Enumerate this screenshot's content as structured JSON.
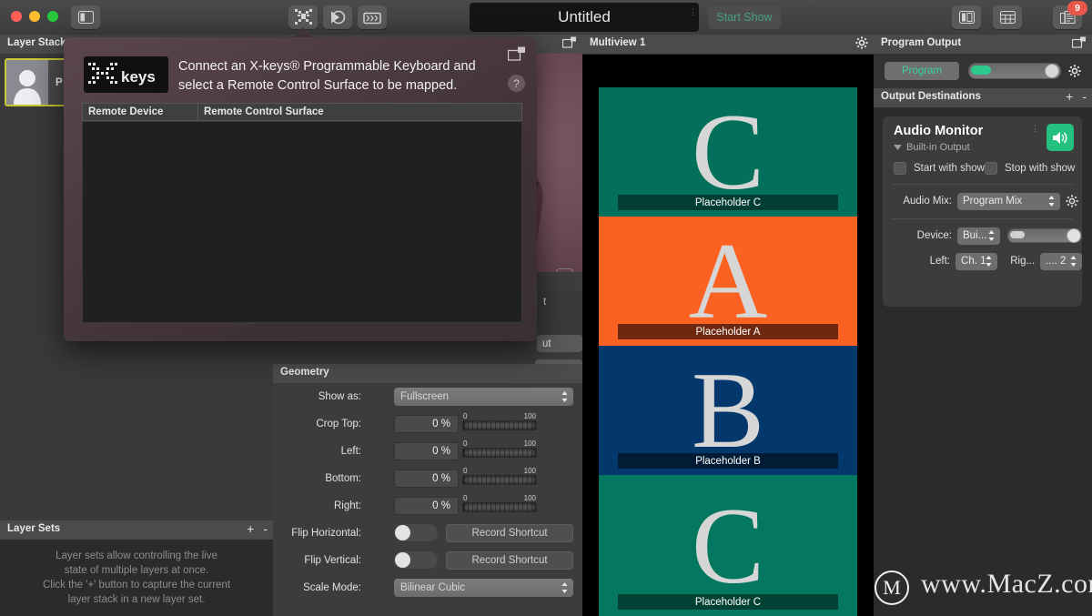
{
  "titlebar": {
    "document_title": "Untitled",
    "start_show_label": "Start Show",
    "layers_badge": "9",
    "buttons": {
      "sidebar_toggle": "sidebar-toggle-icon",
      "xkeys": "x-keys-icon",
      "shortcut": "play-shortcut-icon",
      "media": "clapper-icon",
      "right_sidebar": "right-sidebar-icon",
      "grid": "grid-layout-icon",
      "layers": "layers-icon"
    }
  },
  "left": {
    "layer_stack_title": "Layer Stack",
    "layer_row_name": "P",
    "layer_sets_title": "Layer Sets",
    "layer_sets_add": "+",
    "layer_sets_remove": "-",
    "layer_sets_empty": "Layer sets allow controlling the live\nstate of multiple layers at once.\nClick the '+' button to capture the current\nlayer stack in a new layer set."
  },
  "middle": {
    "partial_label_top": "t",
    "partial_label_btn": "ut",
    "geometry": {
      "title": "Geometry",
      "show_as_label": "Show as:",
      "show_as_value": "Fullscreen",
      "crop_top_label": "Crop Top:",
      "crop_top_value": "0 %",
      "left_label": "Left:",
      "left_value": "0 %",
      "bottom_label": "Bottom:",
      "bottom_value": "0 %",
      "right_label": "Right:",
      "right_value": "0 %",
      "slider_min": "0",
      "slider_max": "100",
      "flip_h_label": "Flip Horizontal:",
      "flip_h_shortcut": "Record Shortcut",
      "flip_v_label": "Flip Vertical:",
      "flip_v_shortcut": "Record Shortcut",
      "scale_mode_label": "Scale Mode:",
      "scale_mode_value": "Bilinear Cubic"
    }
  },
  "multiview": {
    "title": "Multiview 1",
    "tiles": [
      {
        "letter": "C",
        "caption": "Placeholder C",
        "color": "#03705c",
        "cap_color": "#023d33"
      },
      {
        "letter": "A",
        "caption": "Placeholder A",
        "color": "#fb6222",
        "cap_color": "#6e2810"
      },
      {
        "letter": "B",
        "caption": "Placeholder B",
        "color": "#04386c",
        "cap_color": "#021c36"
      },
      {
        "letter": "C",
        "caption": "Placeholder C",
        "color": "#03775f",
        "cap_color": "#024234"
      }
    ]
  },
  "right": {
    "program_output_title": "Program Output",
    "program_button": "Program",
    "output_destinations_title": "Output Destinations",
    "add_label": "+",
    "remove_label": "-",
    "card": {
      "name": "Audio Monitor",
      "device_sub": "Built-in Output",
      "start_with_show": "Start with show",
      "stop_with_show": "Stop with show",
      "audio_mix_label": "Audio Mix:",
      "audio_mix_value": "Program Mix",
      "device_label": "Device:",
      "device_value": "Bui...",
      "left_label": "Left:",
      "left_value": "Ch. 1",
      "right_label": "Rig...",
      "right_value": ".... 2"
    }
  },
  "dialog": {
    "logo_text": "keys",
    "message": "Connect an X-keys® Programmable Keyboard and select a Remote Control Surface to be mapped.",
    "help_label": "?",
    "columns": [
      "Remote Device",
      "Remote Control Surface"
    ],
    "rows": []
  },
  "watermark": {
    "logo": "M",
    "text": "www.MacZ.com"
  },
  "colors": {
    "accent_green": "#2ec98c",
    "badge_red": "#e8584a",
    "selection_yellow": "#c8c832"
  }
}
